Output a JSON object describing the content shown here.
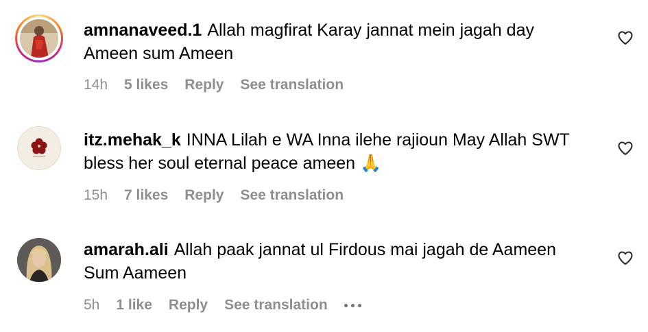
{
  "comments": [
    {
      "username": "amnanaveed.1",
      "text": "Allah magfirat Karay jannat mein jagah day Ameen sum Ameen",
      "time": "14h",
      "likes": "5 likes",
      "reply": "Reply",
      "translate": "See translation",
      "avatar_icon": "profile-photo-woman-red-dress",
      "story_ring": true
    },
    {
      "username": "itz.mehak_k",
      "text": "INNA Lilah e WA Inna ilehe rajioun May Allah SWT bless her soul eternal peace ameen 🙏",
      "time": "15h",
      "likes": "7 likes",
      "reply": "Reply",
      "translate": "See translation",
      "avatar_icon": "flower-logo",
      "story_ring": false
    },
    {
      "username": "amarah.ali",
      "text": "Allah paak jannat ul Firdous mai jagah de Aameen Sum Aameen",
      "time": "5h",
      "likes": "1 like",
      "reply": "Reply",
      "translate": "See translation",
      "avatar_icon": "profile-photo-woman-blonde",
      "story_ring": false,
      "more_icon": "more-options-icon"
    }
  ],
  "colors": {
    "meta_gray": "#8e8e8e",
    "text": "#000000"
  }
}
